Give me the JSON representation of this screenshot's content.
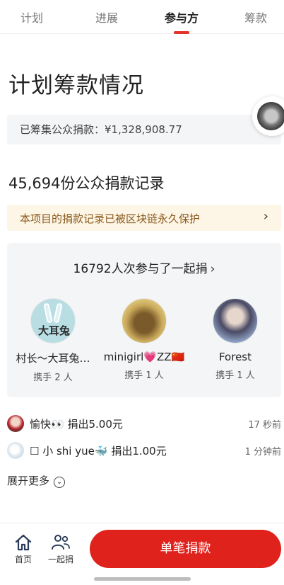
{
  "tabs": [
    {
      "label": "计划"
    },
    {
      "label": "进展"
    },
    {
      "label": "参与方"
    },
    {
      "label": "筹款"
    }
  ],
  "active_tab": "参与方",
  "accent_color": "#e5332a",
  "page_title": "计划筹款情况",
  "raised": {
    "label": "已筹集公众捐款：",
    "amount": "¥1,328,908.77"
  },
  "records_title": "45,694份公众捐款记录",
  "chain_banner": {
    "text": "本项目的捐款记录已被区块链永久保护",
    "icon": "chevron-right-icon"
  },
  "together": {
    "title": "16792人次参与了一起捐",
    "leaders": [
      {
        "name": "村长～大耳兔…",
        "count": "携手 2 人",
        "avatar_text": "大耳兔"
      },
      {
        "name": "minigirl💗ZZ🇨🇳",
        "count": "携手 1 人"
      },
      {
        "name": "Forest",
        "count": "携手 1 人"
      }
    ]
  },
  "feed": [
    {
      "name": "愉快👀",
      "action": "捐出5.00元",
      "time": "17 秒前"
    },
    {
      "name": "☐ 小 shi yue",
      "emoji": "🐳",
      "action": "捐出1.00元",
      "time": "1 分钟前"
    }
  ],
  "expand_label": "展开更多",
  "bottom_nav": [
    {
      "label": "首页",
      "icon": "home-icon"
    },
    {
      "label": "一起捐",
      "icon": "group-icon"
    }
  ],
  "donate_button": "单笔捐款",
  "donate_color": "#e0221c"
}
